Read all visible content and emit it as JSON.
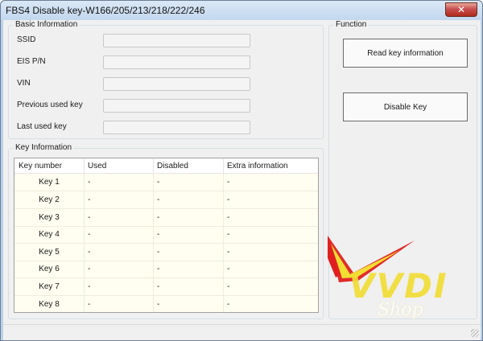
{
  "window": {
    "title": "FBS4 Disable key-W166/205/213/218/222/246",
    "close_glyph": "✕"
  },
  "basic_info": {
    "legend": "Basic Information",
    "fields": [
      {
        "label": "SSID",
        "value": ""
      },
      {
        "label": "EIS P/N",
        "value": ""
      },
      {
        "label": "VIN",
        "value": ""
      },
      {
        "label": "Previous used key",
        "value": ""
      },
      {
        "label": "Last used key",
        "value": ""
      }
    ]
  },
  "function": {
    "legend": "Function",
    "read_button": "Read key information",
    "disable_button": "Disable Key"
  },
  "key_info": {
    "legend": "Key Information",
    "columns": [
      "Key number",
      "Used",
      "Disabled",
      "Extra information"
    ],
    "rows": [
      [
        "Key 1",
        "-",
        "-",
        "-"
      ],
      [
        "Key 2",
        "-",
        "-",
        "-"
      ],
      [
        "Key 3",
        "-",
        "-",
        "-"
      ],
      [
        "Key 4",
        "-",
        "-",
        "-"
      ],
      [
        "Key 5",
        "-",
        "-",
        "-"
      ],
      [
        "Key 6",
        "-",
        "-",
        "-"
      ],
      [
        "Key 7",
        "-",
        "-",
        "-"
      ],
      [
        "Key 8",
        "-",
        "-",
        "-"
      ]
    ]
  },
  "watermark": {
    "brand": "VVDI",
    "sub": "Shop",
    "colors": {
      "red": "#e02020",
      "yellow": "#f2dd33"
    }
  },
  "colors": {
    "titlebar": "#c3d7ee",
    "table_background": "#fffef0"
  }
}
